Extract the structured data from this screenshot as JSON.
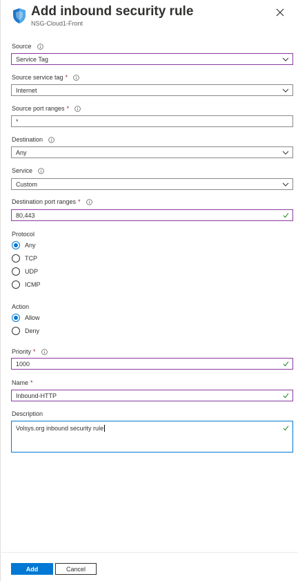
{
  "header": {
    "title": "Add inbound security rule",
    "subtitle": "NSG-Cloud1-Front"
  },
  "fields": {
    "source": {
      "label": "Source",
      "value": "Service Tag"
    },
    "source_service_tag": {
      "label": "Source service tag",
      "required": "*",
      "value": "Internet"
    },
    "source_port_ranges": {
      "label": "Source port ranges",
      "required": "*",
      "value": "*"
    },
    "destination": {
      "label": "Destination",
      "value": "Any"
    },
    "service": {
      "label": "Service",
      "value": "Custom"
    },
    "destination_port_ranges": {
      "label": "Destination port ranges",
      "required": "*",
      "value": "80,443"
    },
    "priority": {
      "label": "Priority",
      "required": "*",
      "value": "1000"
    },
    "name": {
      "label": "Name",
      "required": "*",
      "value": "Inbound-HTTP"
    },
    "description": {
      "label": "Description",
      "value": "Volsys.org  inbound security rule"
    }
  },
  "protocol": {
    "label": "Protocol",
    "options": [
      "Any",
      "TCP",
      "UDP",
      "ICMP"
    ],
    "selected": "Any"
  },
  "action": {
    "label": "Action",
    "options": [
      "Allow",
      "Deny"
    ],
    "selected": "Allow"
  },
  "footer": {
    "add_label": "Add",
    "cancel_label": "Cancel"
  },
  "colors": {
    "accent": "#0078d4",
    "required": "#a4262c",
    "valid_check": "#107c10",
    "field_highlight": "#8a3aa0"
  }
}
